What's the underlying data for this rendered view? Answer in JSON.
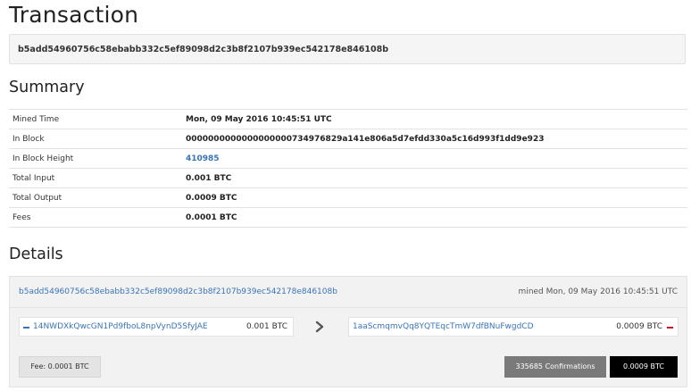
{
  "page_title": "Transaction",
  "tx_hash": "b5add54960756c58ebabb332c5ef89098d2c3b8f2107b939ec542178e846108b",
  "summary": {
    "title": "Summary",
    "rows": [
      {
        "label": "Mined Time",
        "value": "Mon, 09 May 2016 10:45:51 UTC"
      },
      {
        "label": "In Block",
        "value": "0000000000000000000734976829a141e806a5d7efdd330a5c16d993f1dd9e923"
      },
      {
        "label": "In Block Height",
        "value": "410985"
      },
      {
        "label": "Total Input",
        "value": "0.001 BTC"
      },
      {
        "label": "Total Output",
        "value": "0.0009 BTC"
      },
      {
        "label": "Fees",
        "value": "0.0001 BTC"
      }
    ]
  },
  "details": {
    "title": "Details",
    "tx_hash_link": "b5add54960756c58ebabb332c5ef89098d2c3b8f2107b939ec542178e846108b",
    "mined_time": "mined Mon, 09 May 2016 10:45:51 UTC",
    "input": {
      "address": "14NWDXkQwcGN1Pd9fboL8npVynD5SfyJAE",
      "amount": "0.001 BTC"
    },
    "output": {
      "address": "1aaScmqmvQq8YQTEqcTmW7dfBNuFwgdCD",
      "amount": "0.0009 BTC"
    },
    "fee_label": "Fee: 0.0001 BTC",
    "confirmations_label": "335685 Confirmations",
    "total_label": "0.0009 BTC"
  },
  "icons": {
    "input_minus": "minus-icon",
    "output_minus": "minus-icon",
    "arrow": "chevron-right-icon"
  },
  "colors": {
    "link": "#3a74b8",
    "output_marker": "#c8102e",
    "confirmations_bg": "#7a7a7a",
    "total_bg": "#000000"
  }
}
